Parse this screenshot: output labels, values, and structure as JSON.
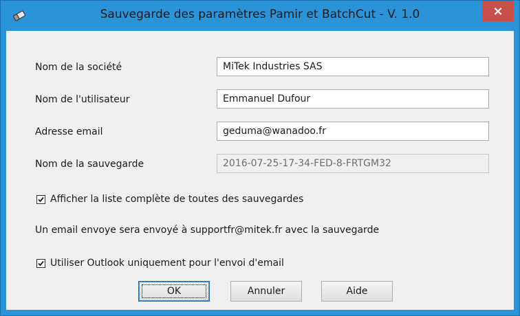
{
  "window": {
    "title": "Sauvegarde des paramètres Pamir et BatchCut - V. 1.0",
    "close_glyph": "×",
    "app_icon": "eraser-icon",
    "titlebar_color": "#2b93d8",
    "close_color": "#c7504a"
  },
  "form": {
    "company_label": "Nom de la société",
    "company_value": "MiTek Industries SAS",
    "user_label": "Nom de l'utilisateur",
    "user_value": "Emmanuel Dufour",
    "email_label": "Adresse email",
    "email_value": "geduma@wanadoo.fr",
    "backup_name_label": "Nom de la sauvegarde",
    "backup_name_value": "2016-07-25-17-34-FED-8-FRTGM32"
  },
  "options": {
    "show_all_label": "Afficher la liste complète de toutes des sauvegardes",
    "show_all_checked": true,
    "info_text": "Un email envoye sera envoyé à supportfr@mitek.fr avec la sauvegarde",
    "outlook_label": "Utiliser Outlook uniquement pour l'envoi d'email",
    "outlook_checked": true
  },
  "buttons": {
    "ok_label": "OK",
    "cancel_label": "Annuler",
    "help_label": "Aide"
  }
}
